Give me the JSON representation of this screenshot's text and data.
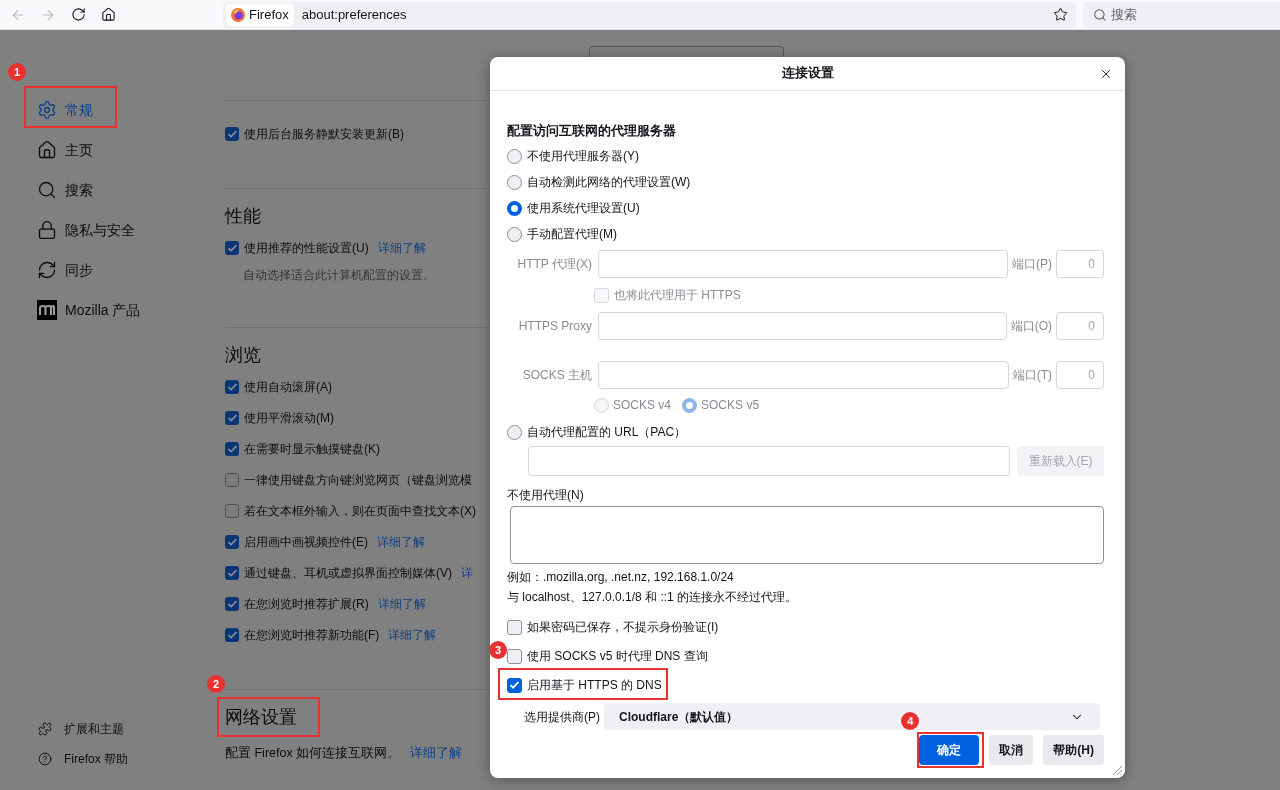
{
  "toolbar": {
    "back": {
      "disabled": true
    },
    "forward": {
      "disabled": true
    },
    "identity": "Firefox",
    "url": "about:preferences",
    "search_placeholder": "搜索"
  },
  "sidebar": {
    "items": [
      {
        "label": "常规",
        "selected": true,
        "callout": "1"
      },
      {
        "label": "主页",
        "selected": false
      },
      {
        "label": "搜索",
        "selected": false
      },
      {
        "label": "隐私与安全",
        "selected": false
      },
      {
        "label": "同步",
        "selected": false
      },
      {
        "label": "Mozilla 产品",
        "selected": false
      }
    ],
    "footer": [
      {
        "label": "扩展和主题"
      },
      {
        "label": "Firefox 帮助"
      }
    ]
  },
  "content": {
    "sections": [
      {
        "rows": [
          {
            "label": "使用后台服务静默安装更新(B)",
            "checked": true
          }
        ]
      },
      {
        "title": "性能",
        "rows": [
          {
            "label": "使用推荐的性能设置(U)",
            "checked": true,
            "link": "详细了解"
          }
        ],
        "note": "自动选择适合此计算机配置的设置。"
      },
      {
        "title": "浏览",
        "rows": [
          {
            "label": "使用自动滚屏(A)",
            "checked": true
          },
          {
            "label": "使用平滑滚动(M)",
            "checked": true
          },
          {
            "label": "在需要时显示触摸键盘(K)",
            "checked": true
          },
          {
            "label": "一律使用键盘方向键浏览网页（键盘浏览模",
            "checked": false
          },
          {
            "label": "若在文本框外输入，则在页面中查找文本(X)",
            "checked": false
          },
          {
            "label": "启用画中画视频控件(E)",
            "checked": true,
            "link": "详细了解"
          },
          {
            "label": "通过键盘、耳机或虚拟界面控制媒体(V)",
            "checked": true,
            "link": "详"
          },
          {
            "label": "在您浏览时推荐扩展(R)",
            "checked": true,
            "link": "详细了解"
          },
          {
            "label": "在您浏览时推荐新功能(F)",
            "checked": true,
            "link": "详细了解"
          }
        ]
      },
      {
        "title": "网络设置",
        "callout": "2",
        "description": "配置 Firefox 如何连接互联网。",
        "link": "详细了解"
      }
    ]
  },
  "dialog": {
    "title": "连接设置",
    "heading": "配置访问互联网的代理服务器",
    "proxy_modes": [
      {
        "label": "不使用代理服务器(Y)",
        "selected": false
      },
      {
        "label": "自动检测此网络的代理设置(W)",
        "selected": false
      },
      {
        "label": "使用系统代理设置(U)",
        "selected": true
      },
      {
        "label": "手动配置代理(M)",
        "selected": false
      },
      {
        "label": "自动代理配置的 URL（PAC）",
        "selected": false
      }
    ],
    "manual": {
      "disabled": true,
      "http": {
        "label": "HTTP 代理(X)",
        "port_label": "端口(P)",
        "port": "0"
      },
      "also_https": {
        "label": "也将此代理用于 HTTPS",
        "checked": false
      },
      "https": {
        "label": "HTTPS Proxy",
        "port_label": "端口(O)",
        "port": "0"
      },
      "socks": {
        "label": "SOCKS 主机",
        "port_label": "端口(T)",
        "port": "0"
      },
      "socks_versions": [
        {
          "label": "SOCKS v4",
          "selected": false
        },
        {
          "label": "SOCKS v5",
          "selected": true
        }
      ]
    },
    "pac": {
      "disabled": true,
      "reload_button": "重新载入(E)"
    },
    "no_proxy": {
      "label": "不使用代理(N)",
      "example": "例如：.mozilla.org, .net.nz, 192.168.1.0/24",
      "note": "与 localhost、127.0.0.1/8 和 ::1 的连接永不经过代理。"
    },
    "options": [
      {
        "label": "如果密码已保存，不提示身份验证(I)",
        "checked": false
      },
      {
        "label": "使用 SOCKS v5 时代理 DNS 查询",
        "checked": false
      },
      {
        "label": "启用基于 HTTPS 的 DNS",
        "checked": true,
        "callout": "3"
      }
    ],
    "provider": {
      "label": "选用提供商(P)",
      "value": "Cloudflare（默认值）"
    },
    "buttons": [
      {
        "label": "确定",
        "kind": "primary",
        "callout": "4"
      },
      {
        "label": "取消",
        "kind": "secondary"
      },
      {
        "label": "帮助(H)",
        "kind": "secondary"
      }
    ]
  }
}
